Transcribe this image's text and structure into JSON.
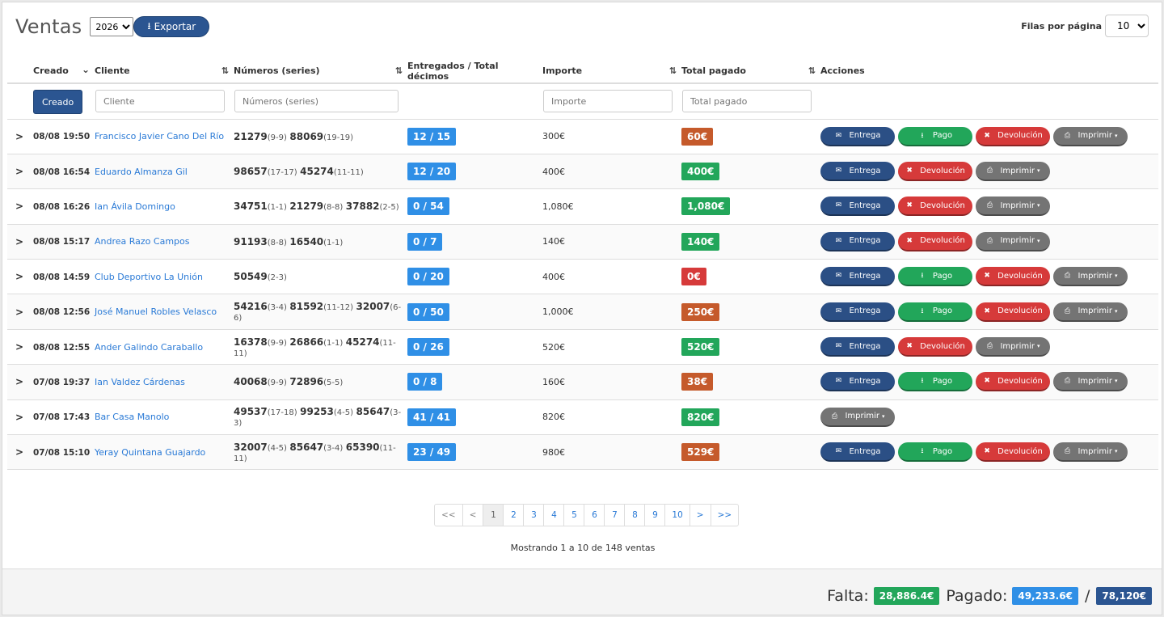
{
  "header": {
    "title": "Ventas",
    "year": "2026",
    "export_label": "Exportar",
    "rows_label": "Filas por página",
    "rows_value": "10"
  },
  "columns": {
    "creado": "Creado",
    "cliente": "Cliente",
    "numeros": "Números (series)",
    "entregados": "Entregados / Total décimos",
    "importe": "Importe",
    "total_pagado": "Total pagado",
    "acciones": "Acciones"
  },
  "filters": {
    "creado_btn": "Creado",
    "cliente_ph": "Cliente",
    "numeros_ph": "Números (series)",
    "importe_ph": "Importe",
    "total_ph": "Total pagado"
  },
  "action_labels": {
    "entrega": "Entrega",
    "pago": "Pago",
    "devolucion": "Devolución",
    "imprimir": "Imprimir"
  },
  "colors": {
    "paid_orange": "#c55a2b",
    "paid_green": "#22a65a",
    "paid_red": "#d63a3a",
    "frac_blue": "#2f8fe6",
    "primary": "#2b5591"
  },
  "rows": [
    {
      "date": "08/08 19:50",
      "client": "Francisco Javier Cano Del Río",
      "nums": [
        {
          "n": "21279",
          "r": "(9-9)"
        },
        {
          "n": "88069",
          "r": "(19-19)"
        }
      ],
      "frac": "12 / 15",
      "importe": "300€",
      "paid": "60€",
      "paid_color": "orange",
      "actions": [
        "entrega",
        "pago",
        "devolucion",
        "imprimir"
      ]
    },
    {
      "date": "08/08 16:54",
      "client": "Eduardo Almanza Gil",
      "nums": [
        {
          "n": "98657",
          "r": "(17-17)"
        },
        {
          "n": "45274",
          "r": "(11-11)"
        }
      ],
      "frac": "12 / 20",
      "importe": "400€",
      "paid": "400€",
      "paid_color": "green",
      "actions": [
        "entrega",
        "devolucion",
        "imprimir"
      ]
    },
    {
      "date": "08/08 16:26",
      "client": "Ian Ávila Domingo",
      "nums": [
        {
          "n": "34751",
          "r": "(1-1)"
        },
        {
          "n": "21279",
          "r": "(8-8)"
        },
        {
          "n": "37882",
          "r": "(2-5)"
        }
      ],
      "frac": "0 / 54",
      "importe": "1,080€",
      "paid": "1,080€",
      "paid_color": "green",
      "actions": [
        "entrega",
        "devolucion",
        "imprimir"
      ]
    },
    {
      "date": "08/08 15:17",
      "client": "Andrea Razo Campos",
      "nums": [
        {
          "n": "91193",
          "r": "(8-8)"
        },
        {
          "n": "16540",
          "r": "(1-1)"
        }
      ],
      "frac": "0 / 7",
      "importe": "140€",
      "paid": "140€",
      "paid_color": "green",
      "actions": [
        "entrega",
        "devolucion",
        "imprimir"
      ]
    },
    {
      "date": "08/08 14:59",
      "client": "Club Deportivo La Unión",
      "nums": [
        {
          "n": "50549",
          "r": "(2-3)"
        }
      ],
      "frac": "0 / 20",
      "importe": "400€",
      "paid": "0€",
      "paid_color": "red",
      "actions": [
        "entrega",
        "pago",
        "devolucion",
        "imprimir"
      ]
    },
    {
      "date": "08/08 12:56",
      "client": "José Manuel Robles Velasco",
      "nums": [
        {
          "n": "54216",
          "r": "(3-4)"
        },
        {
          "n": "81592",
          "r": "(11-12)"
        },
        {
          "n": "32007",
          "r": "(6-6)"
        }
      ],
      "frac": "0 / 50",
      "importe": "1,000€",
      "paid": "250€",
      "paid_color": "orange",
      "actions": [
        "entrega",
        "pago",
        "devolucion",
        "imprimir"
      ]
    },
    {
      "date": "08/08 12:55",
      "client": "Ander Galindo Caraballo",
      "nums": [
        {
          "n": "16378",
          "r": "(9-9)"
        },
        {
          "n": "26866",
          "r": "(1-1)"
        },
        {
          "n": "45274",
          "r": "(11-11)"
        }
      ],
      "frac": "0 / 26",
      "importe": "520€",
      "paid": "520€",
      "paid_color": "green",
      "actions": [
        "entrega",
        "devolucion",
        "imprimir"
      ]
    },
    {
      "date": "07/08 19:37",
      "client": "Ian Valdez Cárdenas",
      "nums": [
        {
          "n": "40068",
          "r": "(9-9)"
        },
        {
          "n": "72896",
          "r": "(5-5)"
        }
      ],
      "frac": "0 / 8",
      "importe": "160€",
      "paid": "38€",
      "paid_color": "orange",
      "actions": [
        "entrega",
        "pago",
        "devolucion",
        "imprimir"
      ]
    },
    {
      "date": "07/08 17:43",
      "client": "Bar Casa Manolo",
      "nums": [
        {
          "n": "49537",
          "r": "(17-18)"
        },
        {
          "n": "99253",
          "r": "(4-5)"
        },
        {
          "n": "85647",
          "r": "(3-3)"
        }
      ],
      "frac": "41 / 41",
      "importe": "820€",
      "paid": "820€",
      "paid_color": "green",
      "actions": [
        "imprimir"
      ]
    },
    {
      "date": "07/08 15:10",
      "client": "Yeray Quintana Guajardo",
      "nums": [
        {
          "n": "32007",
          "r": "(4-5)"
        },
        {
          "n": "85647",
          "r": "(3-4)"
        },
        {
          "n": "65390",
          "r": "(11-11)"
        }
      ],
      "frac": "23 / 49",
      "importe": "980€",
      "paid": "529€",
      "paid_color": "orange",
      "actions": [
        "entrega",
        "pago",
        "devolucion",
        "imprimir"
      ]
    }
  ],
  "pagination": {
    "items": [
      "<<",
      "<",
      "1",
      "2",
      "3",
      "4",
      "5",
      "6",
      "7",
      "8",
      "9",
      "10",
      ">",
      ">>"
    ],
    "active": "1"
  },
  "showing": "Mostrando 1 a 10 de 148 ventas",
  "totals": {
    "falta_label": "Falta:",
    "falta_value": "28,886.4€",
    "pagado_label": "Pagado:",
    "pagado_value": "49,233.6€",
    "separator": "/",
    "total_value": "78,120€"
  }
}
